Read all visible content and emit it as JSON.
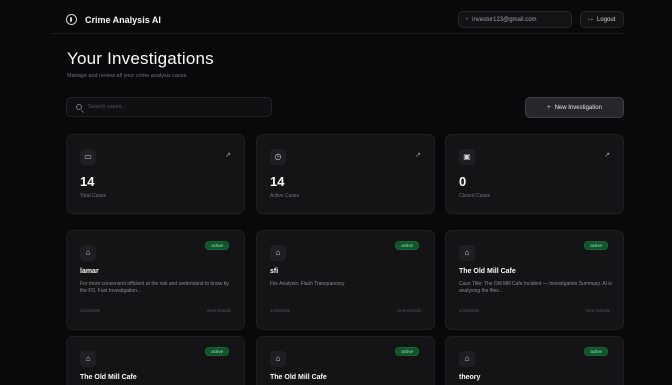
{
  "app": {
    "title": "Crime Analysis AI"
  },
  "header": {
    "email": "investor123@gmail.com",
    "logout_label": "Logout"
  },
  "page": {
    "title": "Your Investigations",
    "subtitle": "Manage and review all your crime analysis cases"
  },
  "search": {
    "placeholder": "Search cases..."
  },
  "new_button": {
    "label": "New Investigation"
  },
  "stats": [
    {
      "icon": "folder-icon",
      "value": "14",
      "label": "Total Cases"
    },
    {
      "icon": "clock-icon",
      "value": "14",
      "label": "Active Cases"
    },
    {
      "icon": "check-square-icon",
      "value": "0",
      "label": "Closed Cases"
    }
  ],
  "investigations": [
    {
      "title": "lamar",
      "status": "active",
      "description": "For more convenient efficient at the risk and understand to know by the FD, Fast Investigation...",
      "date": "1/16/2026",
      "link": "View Details"
    },
    {
      "title": "sfi",
      "status": "active",
      "description": "File Analysis: Flash Transparency",
      "date": "1/16/2026",
      "link": "View Details"
    },
    {
      "title": "The Old Mill Cafe",
      "status": "active",
      "description": "Case Title: The Old Mill Cafe Incident — Investigation Summary. AI is analysing the files...",
      "date": "1/16/2026",
      "link": "View Details"
    },
    {
      "title": "The Old Mill Cafe",
      "status": "active",
      "description": "",
      "date": "",
      "link": ""
    },
    {
      "title": "The Old Mill Cafe",
      "status": "active",
      "description": "",
      "date": "",
      "link": ""
    },
    {
      "title": "theory",
      "status": "active",
      "description": "",
      "date": "",
      "link": ""
    }
  ],
  "colors": {
    "background": "#09090b",
    "card": "#141417",
    "badge_bg": "#14532d",
    "badge_text": "#86efac"
  }
}
